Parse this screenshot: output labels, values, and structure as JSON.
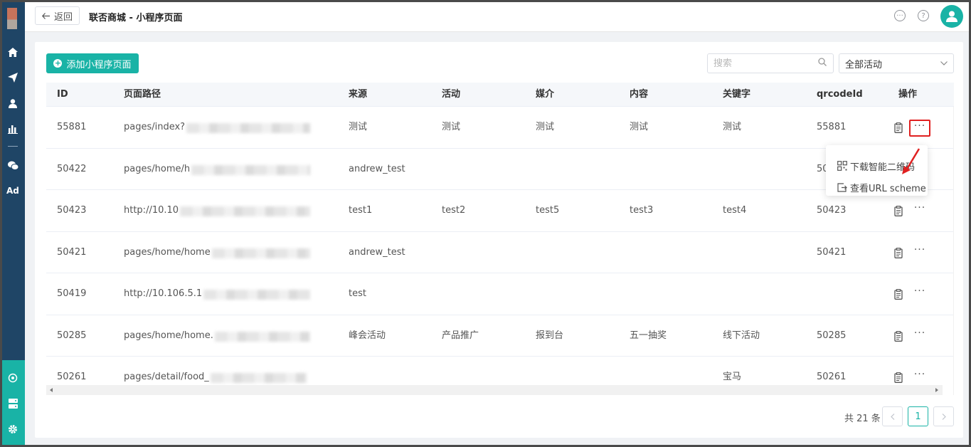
{
  "header": {
    "back_label": "返回",
    "title": "联否商城 - 小程序页面"
  },
  "sidebar": {
    "ad_label": "Ad"
  },
  "toolbar": {
    "add_label": "添加小程序页面",
    "search_placeholder": "搜索",
    "filter_value": "全部活动"
  },
  "table": {
    "columns": [
      "ID",
      "页面路径",
      "来源",
      "活动",
      "媒介",
      "内容",
      "关键字",
      "qrcodeId",
      "操作"
    ],
    "rows": [
      {
        "id": "55881",
        "path": "pages/index?",
        "source": "测试",
        "activity": "测试",
        "medium": "测试",
        "content": "测试",
        "keyword": "测试",
        "qrcode": "55881"
      },
      {
        "id": "50422",
        "path": "pages/home/h",
        "source": "andrew_test",
        "activity": "",
        "medium": "",
        "content": "",
        "keyword": "",
        "qrcode": "50"
      },
      {
        "id": "50423",
        "path": "http://10.10",
        "source": "test1",
        "activity": "test2",
        "medium": "test5",
        "content": "test3",
        "keyword": "test4",
        "qrcode": "50423"
      },
      {
        "id": "50421",
        "path": "pages/home/home",
        "source": "andrew_test",
        "activity": "",
        "medium": "",
        "content": "",
        "keyword": "",
        "qrcode": "50421"
      },
      {
        "id": "50419",
        "path": "http://10.106.5.1",
        "source": "test",
        "activity": "",
        "medium": "",
        "content": "",
        "keyword": "",
        "qrcode": ""
      },
      {
        "id": "50285",
        "path": "pages/home/home.",
        "source": "峰会活动",
        "activity": "产品推广",
        "medium": "报到台",
        "content": "五一抽奖",
        "keyword": "线下活动",
        "qrcode": "50285"
      },
      {
        "id": "50261",
        "path": "pages/detail/food_",
        "source": "",
        "activity": "",
        "medium": "",
        "content": "",
        "keyword": "宝马",
        "qrcode": "50261"
      }
    ]
  },
  "dropdown": {
    "items": [
      "下载智能二维码",
      "查看URL scheme"
    ]
  },
  "pagination": {
    "total_text": "共 21 条",
    "current": "1"
  }
}
